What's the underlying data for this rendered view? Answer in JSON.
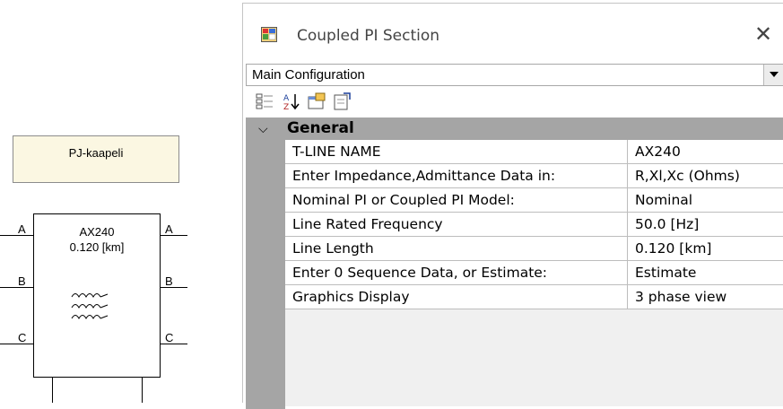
{
  "schematic": {
    "label_box_text": "PJ-kaapeli",
    "component_name": "AX240",
    "component_length": "0.120 [km]",
    "ports_left": [
      "A",
      "B",
      "C"
    ],
    "ports_right": [
      "A",
      "B",
      "C"
    ]
  },
  "window": {
    "title": "Coupled PI Section",
    "close_glyph": "✕",
    "app_icon": "component-window-icon"
  },
  "combo": {
    "selected": "Main Configuration"
  },
  "toolbar": {
    "icons": [
      "categorized-icon",
      "alphabetical-sort-icon",
      "property-pages-icon",
      "export-icon"
    ]
  },
  "grid": {
    "category": "General",
    "rows": [
      {
        "name": "T-LINE NAME",
        "value": "AX240"
      },
      {
        "name": "Enter Impedance,Admittance Data in:",
        "value": "R,Xl,Xc (Ohms)"
      },
      {
        "name": "Nominal PI or Coupled PI Model:",
        "value": "Nominal"
      },
      {
        "name": "Line Rated Frequency",
        "value": "50.0 [Hz]"
      },
      {
        "name": "Line Length",
        "value": "0.120 [km]"
      },
      {
        "name": "Enter 0 Sequence Data, or Estimate:",
        "value": "Estimate"
      },
      {
        "name": "Graphics Display",
        "value": "3 phase view"
      }
    ]
  },
  "colors": {
    "label_box_bg": "#fbf7e2",
    "category_bg": "#a5a5a5",
    "grid_line": "#bdbdbd"
  }
}
